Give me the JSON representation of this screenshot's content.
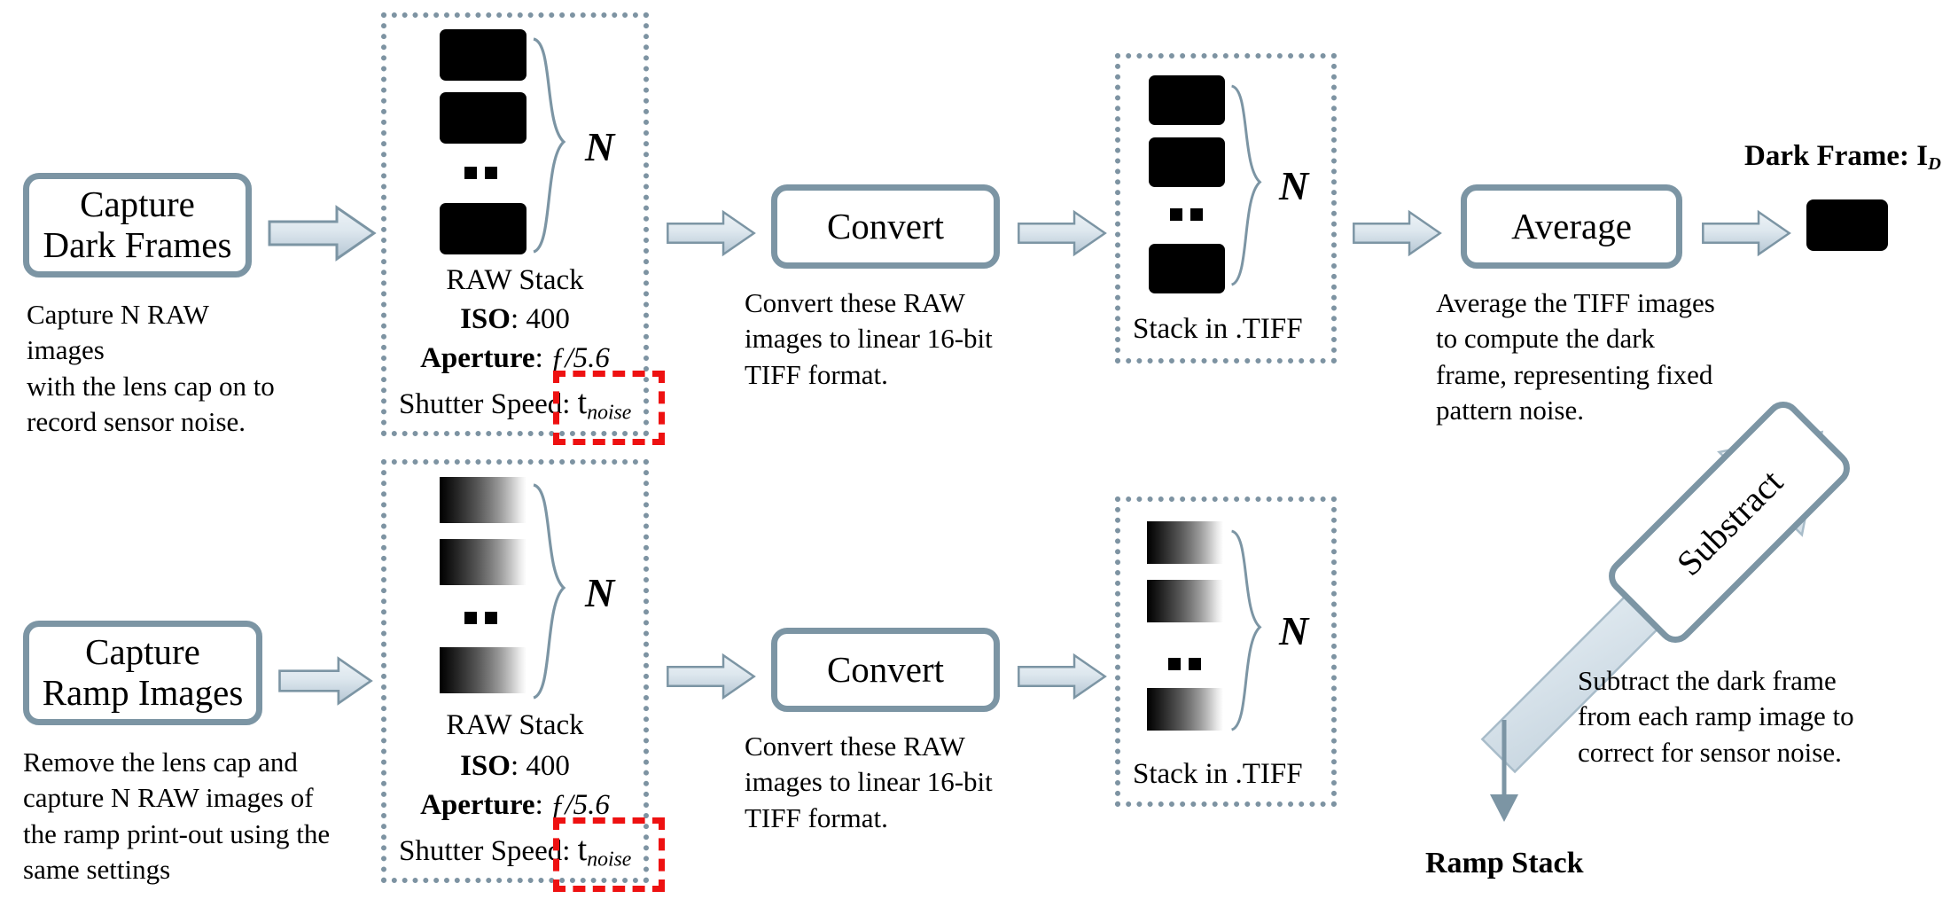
{
  "diagram": {
    "title": "Dark frame subtraction pipeline",
    "colors": {
      "box_border": "#7c95a4",
      "dotted_border": "#7d93a2",
      "highlight_red": "#ee1111",
      "arrow_fill_light": "#e8eef3",
      "arrow_fill_dark": "#b9c9d6",
      "frame_black": "#000000"
    }
  },
  "rows": {
    "top": {
      "step1": {
        "label_line1": "Capture",
        "label_line2": "Dark Frames",
        "caption_line1": "Capture N RAW images",
        "caption_line2": "with the lens cap on to",
        "caption_line3": "record sensor noise."
      },
      "stack_raw": {
        "count_symbol": "N",
        "title": "RAW Stack",
        "iso_key": "ISO",
        "iso_value": "400",
        "aperture_key": "Aperture",
        "aperture_value": "ƒ/5.6",
        "shutter_key": "Shutter Speed",
        "shutter_value_base": "t",
        "shutter_value_sub": "noise",
        "frame_type": "black"
      },
      "step2": {
        "label": "Convert",
        "caption_line1": "Convert these RAW",
        "caption_line2": "images to linear 16-bit",
        "caption_line3": "TIFF format."
      },
      "stack_tiff": {
        "count_symbol": "N",
        "title": "Stack in .TIFF",
        "frame_type": "black"
      },
      "step3": {
        "label": "Average",
        "caption_line1": "Average the TIFF images",
        "caption_line2": "to compute the dark",
        "caption_line3": "frame, representing fixed",
        "caption_line4": "pattern noise."
      },
      "output": {
        "title_base": "Dark Frame: I",
        "title_sub": "D"
      }
    },
    "bottom": {
      "step1": {
        "label_line1": "Capture",
        "label_line2": "Ramp Images",
        "caption_line1": "Remove the lens cap and",
        "caption_line2": "capture N RAW images of",
        "caption_line3": "the ramp print-out using the",
        "caption_line4": "same settings"
      },
      "stack_raw": {
        "count_symbol": "N",
        "title": "RAW Stack",
        "iso_key": "ISO",
        "iso_value": "400",
        "aperture_key": "Aperture",
        "aperture_value": "ƒ/5.6",
        "shutter_key": "Shutter Speed",
        "shutter_value_base": "t",
        "shutter_value_sub": "noise",
        "frame_type": "ramp"
      },
      "step2": {
        "label": "Convert",
        "caption_line1": "Convert these RAW",
        "caption_line2": "images to linear 16-bit",
        "caption_line3": "TIFF format."
      },
      "stack_tiff": {
        "count_symbol": "N",
        "title": "Stack in .TIFF",
        "frame_type": "ramp"
      }
    },
    "merge": {
      "operation_label": "Substract",
      "caption_line1": "Subtract the dark frame",
      "caption_line2": "from each ramp image to",
      "caption_line3": "correct for sensor noise.",
      "result_label": "Ramp Stack"
    }
  }
}
